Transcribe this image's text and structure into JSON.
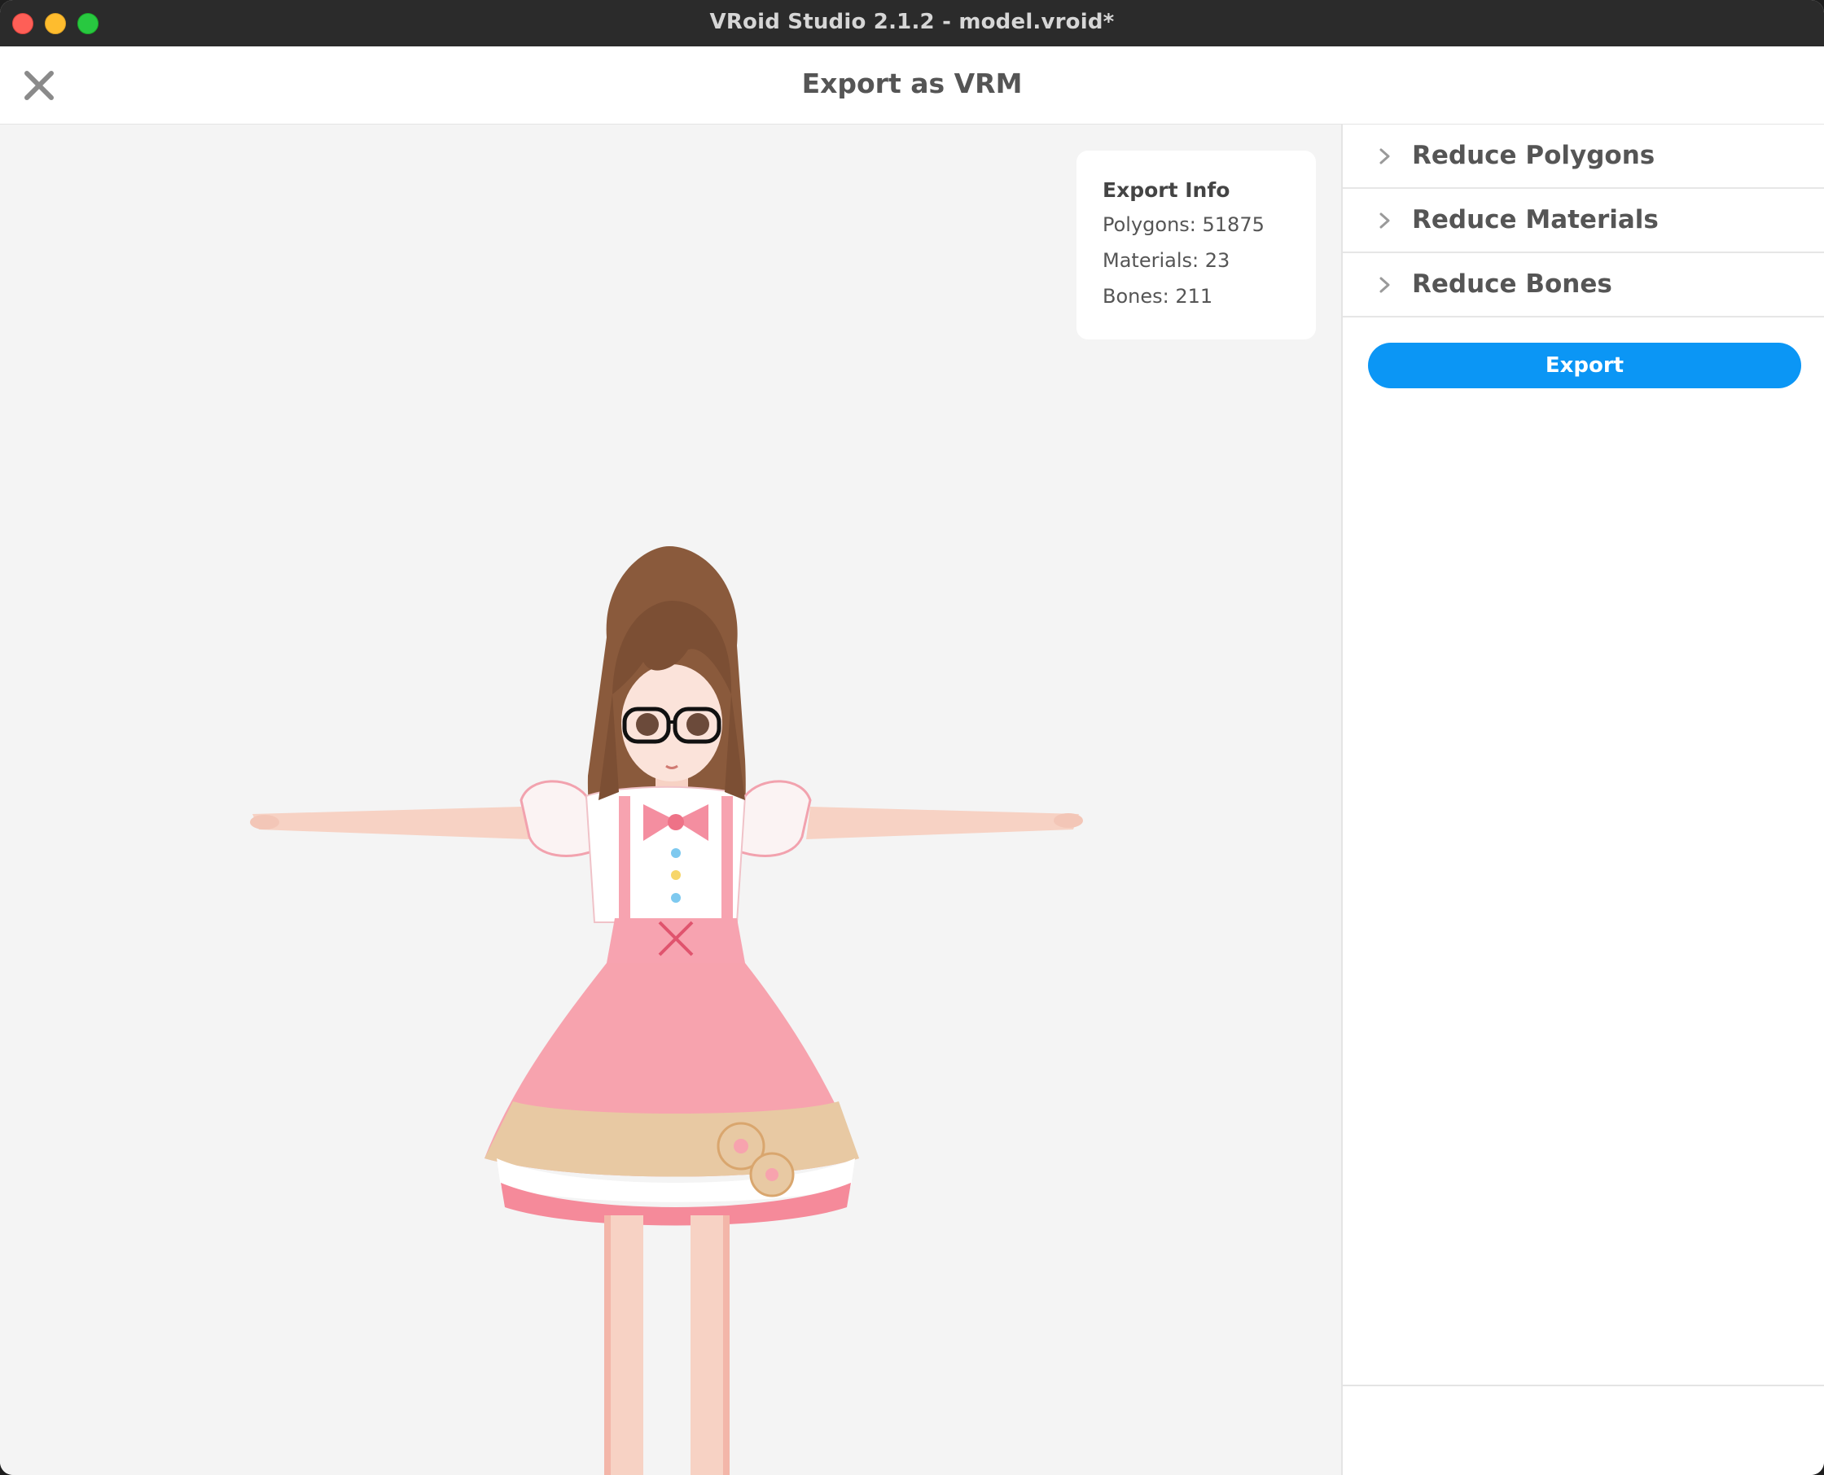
{
  "window": {
    "title": "VRoid Studio 2.1.2 - model.vroid*"
  },
  "header": {
    "title": "Export as VRM"
  },
  "export_info": {
    "title": "Export Info",
    "polygons": "Polygons: 51875",
    "materials": "Materials: 23",
    "bones": "Bones: 211"
  },
  "sidepanel": {
    "sections": [
      {
        "label": "Reduce Polygons"
      },
      {
        "label": "Reduce Materials"
      },
      {
        "label": "Reduce Bones"
      }
    ],
    "export_label": "Export"
  },
  "colors": {
    "accent": "#0b96f5",
    "viewport_bg": "#f4f4f4",
    "titlebar_bg": "#2b2b2b"
  }
}
